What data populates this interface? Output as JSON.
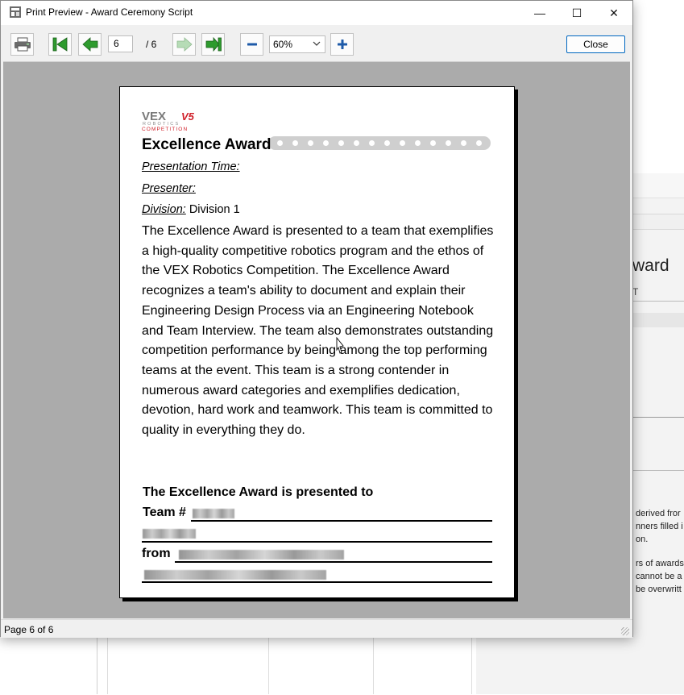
{
  "window": {
    "title": "Print Preview - Award Ceremony Script",
    "minimize_glyph": "—",
    "maximize_glyph": "☐",
    "close_glyph": "✕"
  },
  "toolbar": {
    "current_page": "6",
    "total_pages": "/ 6",
    "zoom": "60%",
    "close_label": "Close",
    "icons": [
      "printer-icon",
      "first-page-icon",
      "previous-page-icon",
      "next-page-icon",
      "last-page-icon",
      "zoom-out-icon",
      "zoom-in-icon"
    ]
  },
  "page": {
    "logo": {
      "brand": "VEX",
      "sub": "ROBOTICS",
      "competition": "COMPETITION",
      "v5": "V5"
    },
    "heading": "Excellence Award",
    "presentation_time_label": "Presentation Time:",
    "presenter_label": "Presenter:",
    "division_label": "Division:",
    "division_value": " Division 1",
    "body": "The Excellence Award is presented to a team that exemplifies a high-quality competitive robotics program and the ethos of the VEX Robotics Competition.  The Excellence Award recognizes a team's ability to document and explain their Engineering Design Process via an Engineering Notebook and Team Interview.  The team also demonstrates outstanding competition performance by being among the top performing teams at the event.  This team is a strong contender in numerous award categories and exemplifies dedication, devotion, hard work and teamwork.  This team is committed to quality in everything they do.",
    "presented_to": "The Excellence Award is presented to",
    "team_label": "Team #",
    "from_label": "from"
  },
  "status": {
    "text": "Page 6 of 6"
  },
  "background_window": {
    "title_fragment": "ward",
    "sub_fragment": "T",
    "lines": [
      "derived fror",
      "nners filled i",
      "on.",
      "rs of awards",
      "cannot be a",
      "be overwritt"
    ]
  },
  "colors": {
    "accent": "#0067c0",
    "nav_green": "#2e9b2e",
    "vex_red": "#d0202a",
    "zoom_blue": "#1e5aa8",
    "viewport_gray": "#ababab"
  }
}
